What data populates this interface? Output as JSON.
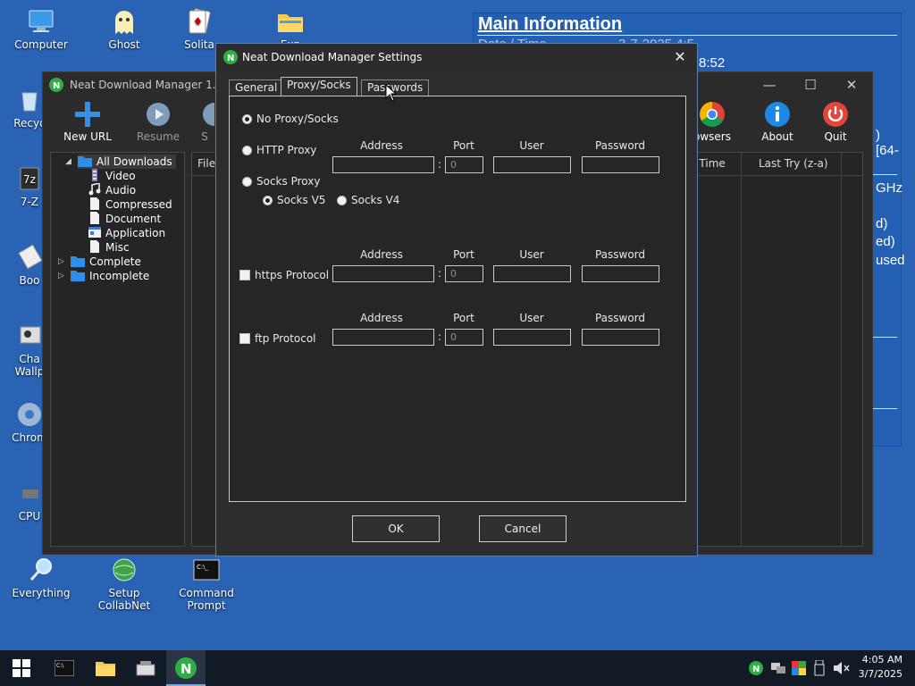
{
  "desktop": {
    "icons": [
      {
        "label": "Computer"
      },
      {
        "label": "Ghost"
      },
      {
        "label": "Solita"
      },
      {
        "label": "Exp"
      },
      {
        "label": "Recyc"
      },
      {
        "label": "7-Z"
      },
      {
        "label": "Boo"
      },
      {
        "label": "Cha\nWallp"
      },
      {
        "label": "Chrom"
      },
      {
        "label": "CPU"
      },
      {
        "label": "Everything"
      },
      {
        "label": "Setup CollabNet"
      },
      {
        "label": "Command\nPrompt"
      }
    ]
  },
  "info_panel": {
    "title": "Main Information",
    "fragments": [
      "Date / Time",
      "3-7-2025 4:5",
      "8:52",
      ") [64-",
      "GHz",
      "d)",
      "ed)",
      "used"
    ]
  },
  "ndm_window": {
    "title": "Neat Download Manager 1.4",
    "toolbar": {
      "new_url": "New URL",
      "resume": "Resume",
      "partial_s": "S",
      "browsers": "owsers",
      "about": "About",
      "quit": "Quit"
    },
    "tree": {
      "all_downloads": "All Downloads",
      "children": [
        "Video",
        "Audio",
        "Compressed",
        "Document",
        "Application",
        "Misc"
      ],
      "complete": "Complete",
      "incomplete": "Incomplete"
    },
    "columns": {
      "file": "File",
      "time": "g Time",
      "last_try": "Last Try (z-a)"
    }
  },
  "settings_dialog": {
    "title": "Neat Download Manager Settings",
    "tabs": {
      "general": "General",
      "proxy": "Proxy/Socks",
      "passwords": "Passwords"
    },
    "options": {
      "no_proxy": "No Proxy/Socks",
      "http_proxy": "HTTP Proxy",
      "socks_proxy": "Socks Proxy",
      "socks_v5": "Socks V5",
      "socks_v4": "Socks V4",
      "https": "https Protocol",
      "ftp": "ftp Protocol"
    },
    "headers": {
      "address": "Address",
      "port": "Port",
      "user": "User",
      "password": "Password"
    },
    "port_value": "0",
    "buttons": {
      "ok": "OK",
      "cancel": "Cancel"
    }
  },
  "taskbar": {
    "time": "4:05 AM",
    "date": "3/7/2025"
  },
  "colors": {
    "desktop": "#2a63b3",
    "window": "#2b2b2b",
    "accent_green": "#2fae43",
    "quit_red": "#e2453b",
    "about_blue": "#1e88e5"
  }
}
